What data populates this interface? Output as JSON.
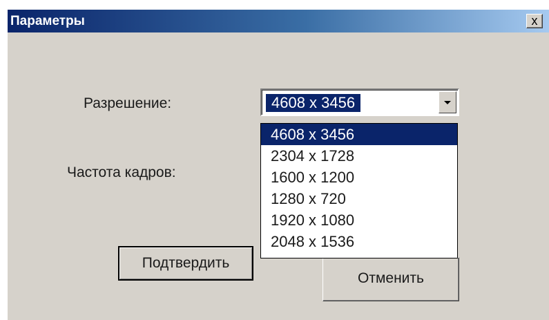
{
  "window": {
    "title": "Параметры",
    "close_label": "x"
  },
  "form": {
    "resolution_label": "Разрешение:",
    "framerate_label": "Частота кадров:",
    "resolution_value": "4608 x 3456"
  },
  "dropdown": {
    "items": [
      {
        "label": "4608 x 3456",
        "selected": true
      },
      {
        "label": "2304 x 1728",
        "selected": false
      },
      {
        "label": "1600 x 1200",
        "selected": false
      },
      {
        "label": "1280 x 720",
        "selected": false
      },
      {
        "label": "1920 x 1080",
        "selected": false
      },
      {
        "label": "2048 x 1536",
        "selected": false
      }
    ]
  },
  "buttons": {
    "confirm_label": "Подтвердить",
    "cancel_label": "Отменить"
  },
  "colors": {
    "title_bar": "#0a246a",
    "dialog_background": "#d6d2cb",
    "selection": "#0a246a"
  }
}
